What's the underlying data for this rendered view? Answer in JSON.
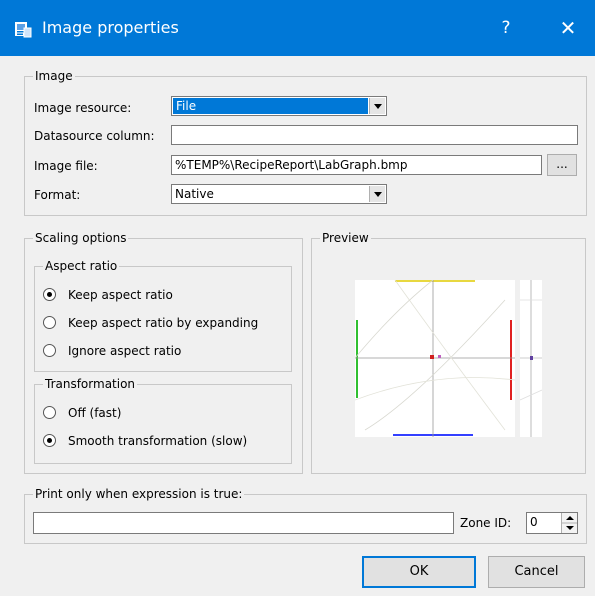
{
  "window": {
    "title": "Image properties",
    "help_label": "?",
    "close_label": "✕"
  },
  "image_group": {
    "title": "Image",
    "resource_label": "Image resource:",
    "resource_value": "File",
    "datasource_label": "Datasource column:",
    "datasource_value": "",
    "file_label": "Image file:",
    "file_value": "%TEMP%\\RecipeReport\\LabGraph.bmp",
    "browse_label": "...",
    "format_label": "Format:",
    "format_value": "Native"
  },
  "scaling_group": {
    "title": "Scaling options",
    "aspect_title": "Aspect ratio",
    "aspect_options": [
      "Keep aspect ratio",
      "Keep aspect ratio by expanding",
      "Ignore aspect ratio"
    ],
    "aspect_selected": 0,
    "transform_title": "Transformation",
    "transform_options": [
      "Off (fast)",
      "Smooth transformation (slow)"
    ],
    "transform_selected": 1
  },
  "preview_group": {
    "title": "Preview"
  },
  "print_group": {
    "title": "Print only when expression is true:",
    "expression_value": "",
    "zone_label": "Zone ID:",
    "zone_value": "0"
  },
  "buttons": {
    "ok": "OK",
    "cancel": "Cancel"
  },
  "colors": {
    "titlebar": "#0078d7",
    "selection": "#0078d7"
  }
}
